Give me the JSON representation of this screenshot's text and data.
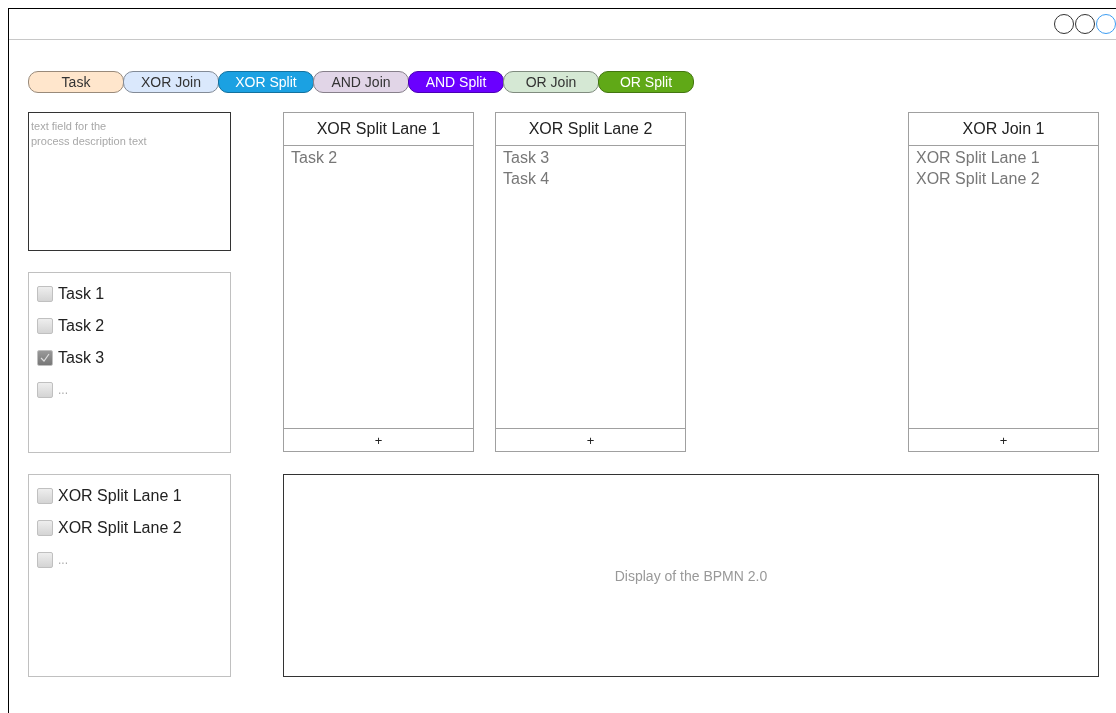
{
  "window": {
    "buttons": [
      {
        "color": "#333333"
      },
      {
        "color": "#333333"
      },
      {
        "color": "#3d9df2"
      }
    ]
  },
  "palette": [
    {
      "label": "Task",
      "color": "#ffe6cc"
    },
    {
      "label": "XOR Join",
      "color": "#dae8fc"
    },
    {
      "label": "XOR Split",
      "color": "#1ba1e2"
    },
    {
      "label": "AND Join",
      "color": "#e1d5e7"
    },
    {
      "label": "AND Split",
      "color": "#6a00ff"
    },
    {
      "label": "OR Join",
      "color": "#d5e8d4"
    },
    {
      "label": "OR Split",
      "color": "#60a917"
    }
  ],
  "description": {
    "placeholder": "text field for the\nprocess description text"
  },
  "task_list": [
    {
      "kind": "item",
      "label": "Task 1",
      "checked": false
    },
    {
      "kind": "item",
      "label": "Task 2",
      "checked": false
    },
    {
      "kind": "item",
      "label": "Task 3",
      "checked": true
    },
    {
      "kind": "more",
      "label": "...",
      "checked": false
    }
  ],
  "lane_list": [
    {
      "kind": "item",
      "label": "XOR Split Lane 1",
      "checked": false
    },
    {
      "kind": "item",
      "label": "XOR Split Lane 2",
      "checked": false
    },
    {
      "kind": "more",
      "label": "...",
      "checked": false
    }
  ],
  "lanes": [
    {
      "kind": "split",
      "title": "XOR Split Lane 1",
      "items": [
        "Task 2"
      ],
      "add": "+"
    },
    {
      "kind": "split",
      "title": "XOR Split Lane 2",
      "items": [
        "Task 3",
        "Task 4"
      ],
      "add": "+"
    },
    {
      "kind": "join",
      "title": "XOR Join 1",
      "items": [
        "XOR Split Lane 1",
        "XOR Split Lane 2"
      ],
      "add": "+"
    }
  ],
  "display": {
    "text": "Display of the BPMN 2.0"
  }
}
